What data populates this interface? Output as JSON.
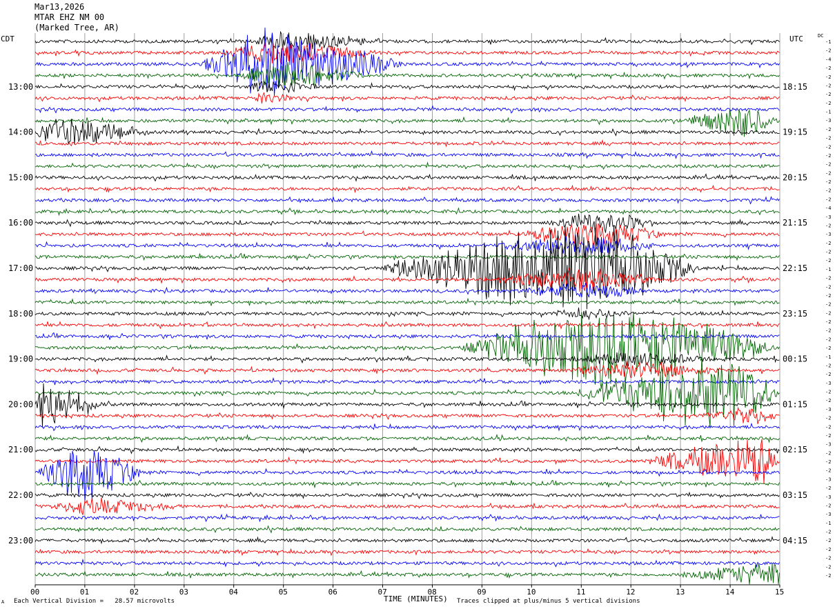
{
  "header": {
    "date": "Mar13,2026",
    "station": "MTAR EHZ NM 00",
    "location": "(Marked Tree, AR)"
  },
  "labels": {
    "left_zone": "CDT",
    "right_zone": "UTC",
    "dc": "DC",
    "x_axis_title": "TIME (MINUTES)",
    "scale_note": "Each Vertical Division =   28.57 microvolts",
    "clip_note": "Traces clipped at plus/minus 5 vertical divisions",
    "corner_mark": "A"
  },
  "colors": {
    "trace_cycle": [
      "#000000",
      "#ff0000",
      "#0000ff",
      "#006400"
    ],
    "grid": "#a0a0a0",
    "background": "#ffffff"
  },
  "chart_data": {
    "type": "line",
    "title": "MTAR EHZ NM 00",
    "x_unit": "minutes",
    "xlim": [
      0,
      15
    ],
    "x_ticks": [
      "00",
      "01",
      "02",
      "03",
      "04",
      "05",
      "06",
      "07",
      "08",
      "09",
      "10",
      "11",
      "12",
      "13",
      "14",
      "15"
    ],
    "lines_per_hour": 4,
    "left_time_labels": [
      "13:00",
      "14:00",
      "15:00",
      "16:00",
      "17:00",
      "18:00",
      "19:00",
      "20:00",
      "21:00",
      "22:00",
      "23:00"
    ],
    "right_time_labels": [
      "18:15",
      "19:15",
      "20:15",
      "21:15",
      "22:15",
      "23:15",
      "00:15",
      "01:15",
      "02:15",
      "03:15",
      "04:15"
    ],
    "dc_offsets": [
      -1,
      -2,
      -4,
      -2,
      -2,
      -2,
      -2,
      -2,
      -1,
      -3,
      -2,
      -2,
      -2,
      -2,
      -2,
      -2,
      -2,
      -2,
      -2,
      -4,
      -3,
      -2,
      -3,
      -2,
      -2,
      -2,
      -1,
      -2,
      -2,
      -2,
      -2,
      -2,
      -2,
      -2,
      -2,
      -2,
      -1,
      -2,
      -2,
      -3,
      -2,
      -2,
      -3,
      -2,
      -2,
      -2,
      -3,
      -2,
      -2,
      -2,
      -3,
      -2,
      -3,
      -2,
      -3,
      -1,
      -2,
      -2,
      -2,
      -2,
      -2,
      -2
    ],
    "traces": 48,
    "events": [
      {
        "trace": 0,
        "start": 4.4,
        "end": 7.3,
        "peak": 4.8,
        "amp": 1.1
      },
      {
        "trace": 1,
        "start": 3.6,
        "end": 7.2,
        "peak": 4.8,
        "amp": 1.2
      },
      {
        "trace": 2,
        "start": 3.3,
        "end": 7.5,
        "peak": 4.6,
        "amp": 3.6
      },
      {
        "trace": 3,
        "start": 4.0,
        "end": 6.8,
        "peak": 4.9,
        "amp": 1.4
      },
      {
        "trace": 4,
        "start": 4.2,
        "end": 6.0,
        "peak": 4.6,
        "amp": 0.8
      },
      {
        "trace": 5,
        "start": 4.3,
        "end": 5.5,
        "peak": 4.6,
        "amp": 0.6
      },
      {
        "trace": 7,
        "start": 13.0,
        "end": 15.0,
        "peak": 14.3,
        "amp": 1.8
      },
      {
        "trace": 8,
        "start": 0.0,
        "end": 2.6,
        "peak": 0.3,
        "amp": 1.6
      },
      {
        "trace": 16,
        "start": 10.2,
        "end": 12.7,
        "peak": 11.3,
        "amp": 1.2
      },
      {
        "trace": 17,
        "start": 9.6,
        "end": 12.8,
        "peak": 11.2,
        "amp": 1.5
      },
      {
        "trace": 18,
        "start": 9.0,
        "end": 12.7,
        "peak": 11.0,
        "amp": 1.2
      },
      {
        "trace": 20,
        "start": 6.9,
        "end": 13.4,
        "peak": 11.0,
        "amp": 5.0
      },
      {
        "trace": 21,
        "start": 8.9,
        "end": 12.8,
        "peak": 11.0,
        "amp": 1.2
      },
      {
        "trace": 22,
        "start": 9.6,
        "end": 12.5,
        "peak": 11.0,
        "amp": 0.9
      },
      {
        "trace": 24,
        "start": 10.1,
        "end": 12.4,
        "peak": 11.0,
        "amp": 0.6
      },
      {
        "trace": 27,
        "start": 8.5,
        "end": 15.0,
        "peak": 11.5,
        "amp": 4.5
      },
      {
        "trace": 28,
        "start": 10.5,
        "end": 14.0,
        "peak": 12.0,
        "amp": 0.8
      },
      {
        "trace": 29,
        "start": 10.6,
        "end": 14.2,
        "peak": 12.0,
        "amp": 1.0
      },
      {
        "trace": 31,
        "start": 10.8,
        "end": 15.0,
        "peak": 14.0,
        "amp": 4.0
      },
      {
        "trace": 32,
        "start": 0.0,
        "end": 1.4,
        "peak": 0.15,
        "amp": 2.6
      },
      {
        "trace": 33,
        "start": 13.2,
        "end": 15.0,
        "peak": 14.5,
        "amp": 1.0
      },
      {
        "trace": 37,
        "start": 12.2,
        "end": 15.0,
        "peak": 14.6,
        "amp": 2.6
      },
      {
        "trace": 38,
        "start": 0.0,
        "end": 2.2,
        "peak": 0.9,
        "amp": 3.2
      },
      {
        "trace": 41,
        "start": 0.2,
        "end": 3.3,
        "peak": 1.0,
        "amp": 0.9
      },
      {
        "trace": 47,
        "start": 12.8,
        "end": 15.0,
        "peak": 15.0,
        "amp": 1.4
      }
    ]
  }
}
